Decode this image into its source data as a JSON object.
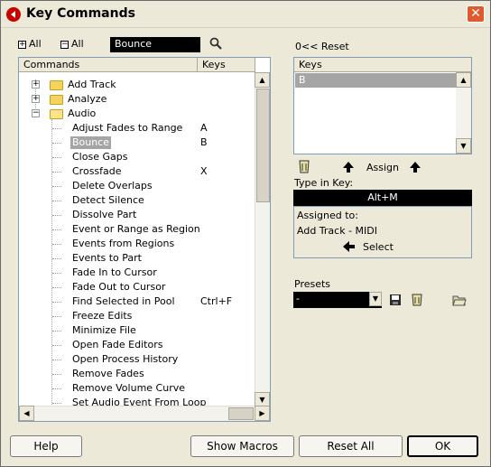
{
  "window": {
    "title": "Key Commands"
  },
  "toolbar": {
    "expand_all_label": "All",
    "collapse_all_label": "All",
    "search_value": "Bounce",
    "reset_label": "0<< Reset"
  },
  "commands_list": {
    "col_commands": "Commands",
    "col_keys": "Keys",
    "folders": [
      "Add Track",
      "Analyze",
      "Audio"
    ],
    "items": [
      {
        "label": "Adjust Fades to Range",
        "key": "A"
      },
      {
        "label": "Bounce",
        "key": "B"
      },
      {
        "label": "Close Gaps",
        "key": ""
      },
      {
        "label": "Crossfade",
        "key": "X"
      },
      {
        "label": "Delete Overlaps",
        "key": ""
      },
      {
        "label": "Detect Silence",
        "key": ""
      },
      {
        "label": "Dissolve Part",
        "key": ""
      },
      {
        "label": "Event or Range as Region",
        "key": ""
      },
      {
        "label": "Events from Regions",
        "key": ""
      },
      {
        "label": "Events to Part",
        "key": ""
      },
      {
        "label": "Fade In to Cursor",
        "key": ""
      },
      {
        "label": "Fade Out to Cursor",
        "key": ""
      },
      {
        "label": "Find Selected in Pool",
        "key": "Ctrl+F"
      },
      {
        "label": "Freeze Edits",
        "key": ""
      },
      {
        "label": "Minimize File",
        "key": ""
      },
      {
        "label": "Open Fade Editors",
        "key": ""
      },
      {
        "label": "Open Process History",
        "key": ""
      },
      {
        "label": "Remove Fades",
        "key": ""
      },
      {
        "label": "Remove Volume Curve",
        "key": ""
      },
      {
        "label": "Set Audio Event From Loop",
        "key": ""
      }
    ]
  },
  "keys_panel": {
    "header": "Keys",
    "selected_key": "B"
  },
  "assign": {
    "label": "Assign"
  },
  "type_in_key": {
    "label": "Type in Key:",
    "value": "Alt+M"
  },
  "assigned_to": {
    "label": "Assigned to:",
    "value": "Add Track - MIDI",
    "select_label": "Select"
  },
  "presets": {
    "label": "Presets",
    "value": "-"
  },
  "buttons": {
    "help": "Help",
    "show_macros": "Show Macros",
    "reset_all": "Reset All",
    "ok": "OK"
  }
}
